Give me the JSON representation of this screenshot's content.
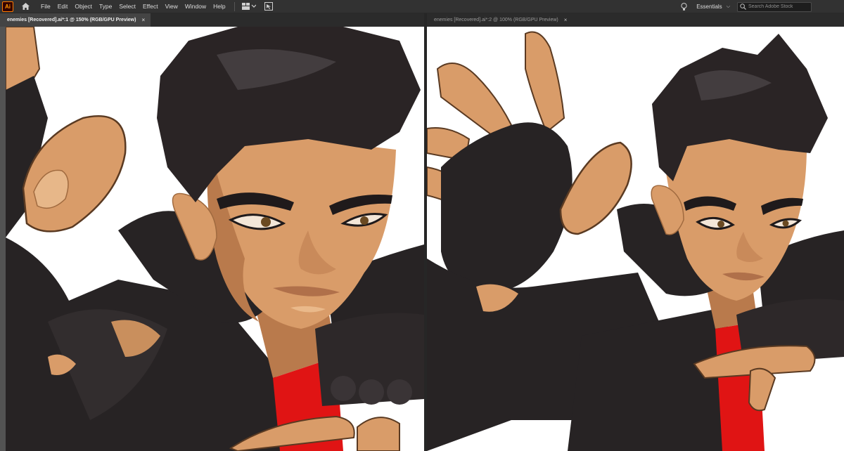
{
  "app": {
    "logo_text": "Ai",
    "accent_color": "#ff7c00"
  },
  "menu": {
    "items": [
      {
        "label": "File"
      },
      {
        "label": "Edit"
      },
      {
        "label": "Object"
      },
      {
        "label": "Type"
      },
      {
        "label": "Select"
      },
      {
        "label": "Effect"
      },
      {
        "label": "View"
      },
      {
        "label": "Window"
      },
      {
        "label": "Help"
      }
    ]
  },
  "toolbar": {
    "layout_icon": "workspace-layout-icon",
    "gpu_icon": "gpu-performance-icon"
  },
  "workspace": {
    "label": "Essentials"
  },
  "search": {
    "placeholder": "Search Adobe Stock"
  },
  "documents": [
    {
      "tab_title": "enemies [Recovered].ai*:1 @ 150% (RGB/GPU Preview)",
      "close": "×",
      "active": true
    },
    {
      "tab_title": "enemies [Recovered].ai*:2 @ 100% (RGB/GPU Preview)",
      "close": "×",
      "active": false
    }
  ],
  "artwork": {
    "description_icon": "character-illustration",
    "colors": {
      "skin": "#d99c69",
      "skin_shadow": "#b97a4c",
      "hair": "#2a2425",
      "jacket": "#272324",
      "jacket_highlight": "#4a4446",
      "shirt": "#e01414",
      "outline": "#5a3a22"
    }
  }
}
